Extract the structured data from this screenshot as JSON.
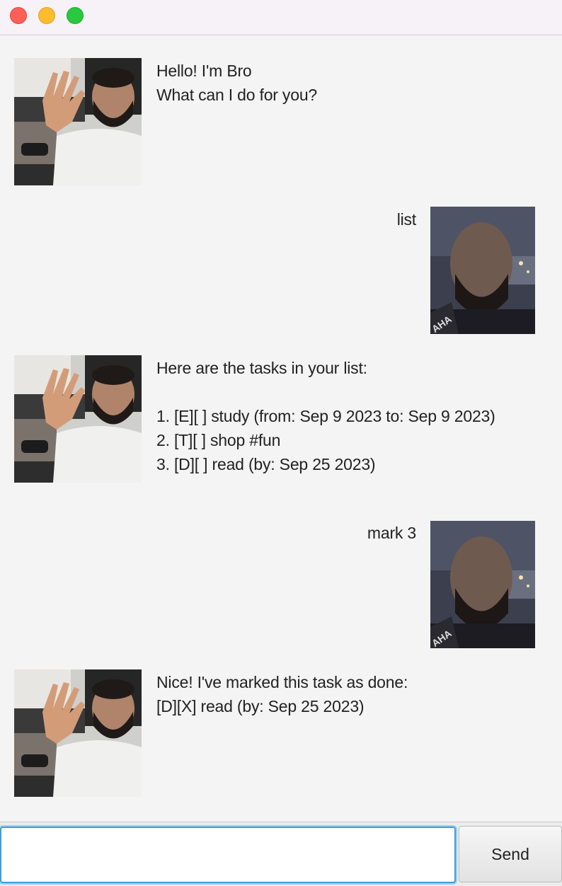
{
  "window": {
    "controls": [
      "close",
      "minimize",
      "maximize"
    ]
  },
  "messages": [
    {
      "from": "bot",
      "text": "Hello! I'm Bro\nWhat can I do for you?"
    },
    {
      "from": "user",
      "text": "list"
    },
    {
      "from": "bot",
      "text": "Here are the tasks in your list:\n\n1. [E][ ] study (from: Sep 9 2023 to: Sep 9 2023)\n2. [T][ ] shop #fun\n3. [D][ ] read (by: Sep 25 2023)"
    },
    {
      "from": "user",
      "text": "mark 3"
    },
    {
      "from": "bot",
      "text": "Nice! I've marked this task as done:\n[D][X] read (by: Sep 25 2023)"
    }
  ],
  "input": {
    "value": "",
    "placeholder": ""
  },
  "send_button": {
    "label": "Send"
  },
  "colors": {
    "background": "#f4f4f4",
    "input_focus": "#3aa0d8",
    "close": "#fe5f57",
    "minimize": "#febc2e",
    "maximize": "#28c840"
  }
}
